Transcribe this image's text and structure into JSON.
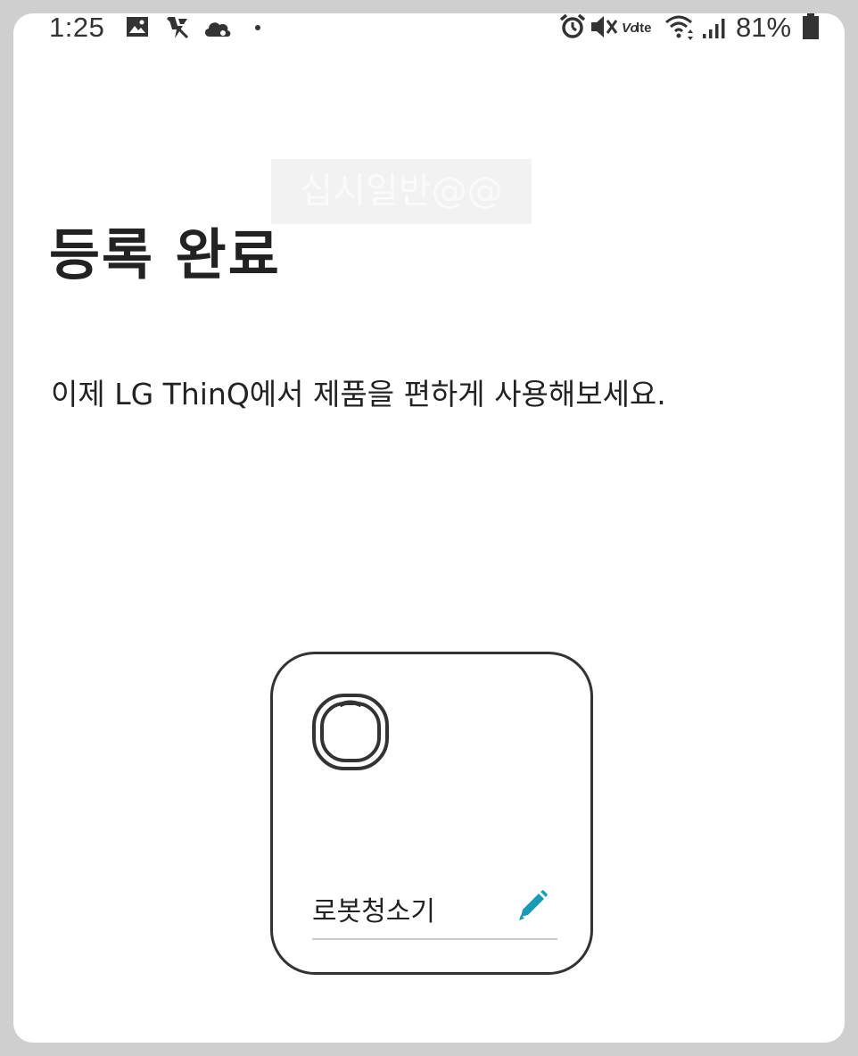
{
  "status_bar": {
    "time": "1:25",
    "battery": "81%",
    "left_icons": [
      "gallery-icon",
      "no-flash-icon",
      "cloud-icon",
      "dot-icon"
    ],
    "right_icons": [
      "alarm-icon",
      "mute-icon",
      "volte-icon",
      "wifi-icon",
      "signal-icon",
      "battery-icon"
    ],
    "volte_label": "Vo lte"
  },
  "watermark": {
    "text": "십시일반@@"
  },
  "main": {
    "title": "등록 완료",
    "subtitle": "이제 LG ThinQ에서 제품을 편하게 사용해보세요."
  },
  "device_card": {
    "device_name": "로봇청소기",
    "device_icon": "robot-vacuum-icon",
    "edit_icon": "pencil-icon",
    "accent_color": "#1a9bb5"
  },
  "colors": {
    "background": "#ffffff",
    "frame": "#cfcfcf",
    "text": "#222222",
    "card_border": "#333333"
  }
}
